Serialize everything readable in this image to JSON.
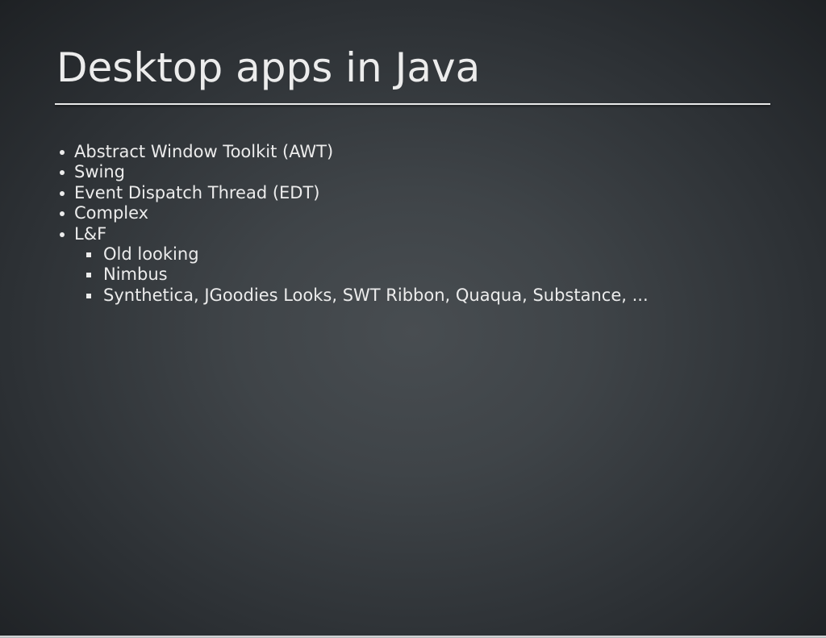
{
  "slide": {
    "title": "Desktop apps in Java",
    "bullets": [
      {
        "label": "Abstract Window Toolkit (AWT)"
      },
      {
        "label": "Swing"
      },
      {
        "label": "Event Dispatch Thread (EDT)"
      },
      {
        "label": "Complex"
      },
      {
        "label": "L&F",
        "children": [
          "Old looking",
          "Nimbus",
          "Synthetica, JGoodies Looks, SWT Ribbon, Quaqua, Substance, ..."
        ]
      }
    ]
  },
  "theme": {
    "bg-center": "#484d51",
    "bg-edge": "#1e2124",
    "text-color": "#ececec",
    "rule-color": "#e9eaea",
    "bottom-edge-light": "#e3e6e6",
    "bottom-edge-color": "#aeb3b5"
  }
}
